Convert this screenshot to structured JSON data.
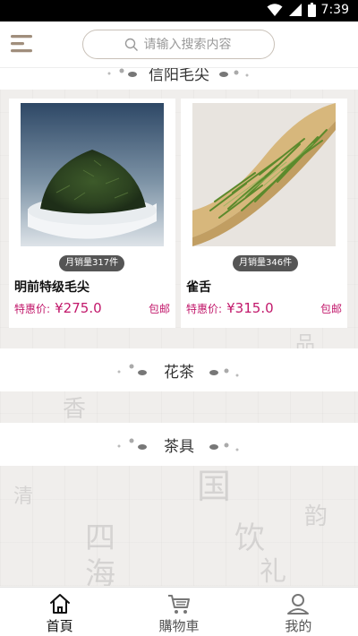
{
  "status_bar": {
    "time": "7:39",
    "icons": [
      "wifi-icon",
      "signal-icon",
      "battery-icon"
    ]
  },
  "header": {
    "menu_icon": "menu-icon",
    "search_placeholder": "请输入搜索内容",
    "search_icon": "search-icon"
  },
  "top_category": {
    "label": "信阳毛尖"
  },
  "products": [
    {
      "sales": "月销量317件",
      "name": "明前特级毛尖",
      "price_label": "特惠价:",
      "price": "¥275.0",
      "shipping": "包邮"
    },
    {
      "sales": "月销量346件",
      "name": "雀舌",
      "price_label": "特惠价:",
      "price": "¥315.0",
      "shipping": "包邮"
    }
  ],
  "categories": [
    {
      "label": "花茶"
    },
    {
      "label": "茶具"
    }
  ],
  "bottom_nav": [
    {
      "label": "首頁",
      "icon": "home-icon",
      "active": true
    },
    {
      "label": "購物車",
      "icon": "cart-icon",
      "active": false
    },
    {
      "label": "我的",
      "icon": "user-icon",
      "active": false
    }
  ],
  "colors": {
    "accent": "#c2186b",
    "nav_active": "#111111",
    "nav_inactive": "#555555",
    "menu_icon": "#a08e7c"
  }
}
